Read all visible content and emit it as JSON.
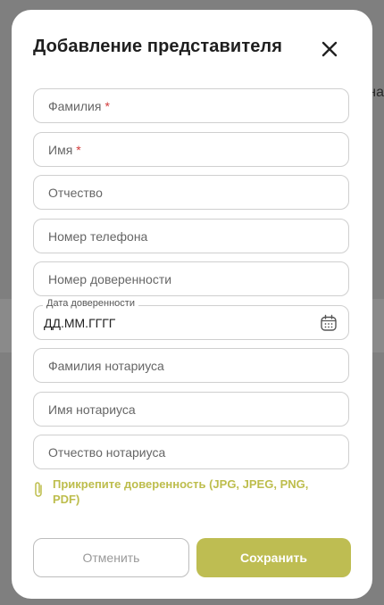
{
  "modal": {
    "title": "Добавление представителя",
    "fields": [
      {
        "placeholder": "Фамилия",
        "required": "*"
      },
      {
        "placeholder": "Имя",
        "required": "*"
      },
      {
        "placeholder": "Отчество"
      },
      {
        "placeholder": "Номер телефона"
      },
      {
        "placeholder": "Номер доверенности"
      },
      {
        "label": "Дата доверенности",
        "value": "ДД.ММ.ГГГГ",
        "icon": "calendar-icon"
      },
      {
        "placeholder": "Фамилия нотариуса"
      },
      {
        "placeholder": "Имя нотариуса"
      },
      {
        "placeholder": "Отчество нотариуса"
      }
    ],
    "attach": {
      "label": "Прикрепите доверенность (JPG, JPEG, PNG, PDF)",
      "icon": "paperclip-icon"
    },
    "buttons": {
      "cancel": "Отменить",
      "save": "Сохранить"
    },
    "close_icon": "close-icon"
  },
  "background": {
    "partial_text": "на"
  },
  "colors": {
    "accent": "#bebd52",
    "required": "#d23b3b",
    "border": "#cfcfcf"
  }
}
